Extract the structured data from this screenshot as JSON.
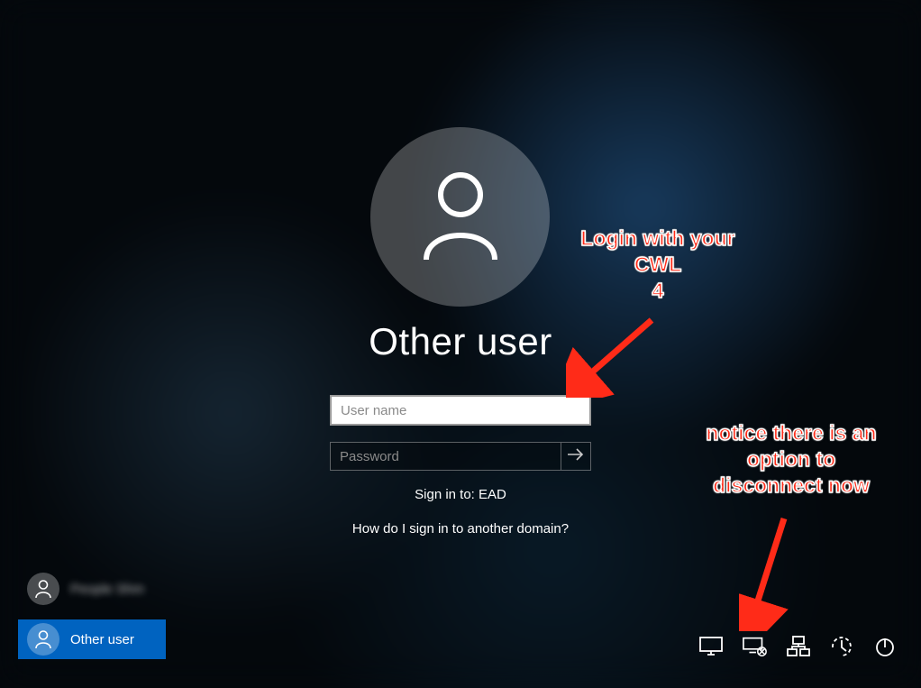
{
  "login": {
    "title": "Other user",
    "username_placeholder": "User name",
    "username_value": "",
    "password_placeholder": "Password",
    "password_value": "",
    "signin_to": "Sign in to: EAD",
    "other_domain": "How do I sign in to another domain?"
  },
  "user_list": [
    {
      "label": "People Shm"
    },
    {
      "label": "Other user"
    }
  ],
  "tray_icons": [
    "monitor-icon",
    "disconnect-icon",
    "network-icon",
    "ease-of-access-icon",
    "power-icon"
  ],
  "annotations": {
    "login_hint": "Login with your\nCWL\n4",
    "disconnect_hint": "notice there is an\noption to\ndisconnect now"
  }
}
